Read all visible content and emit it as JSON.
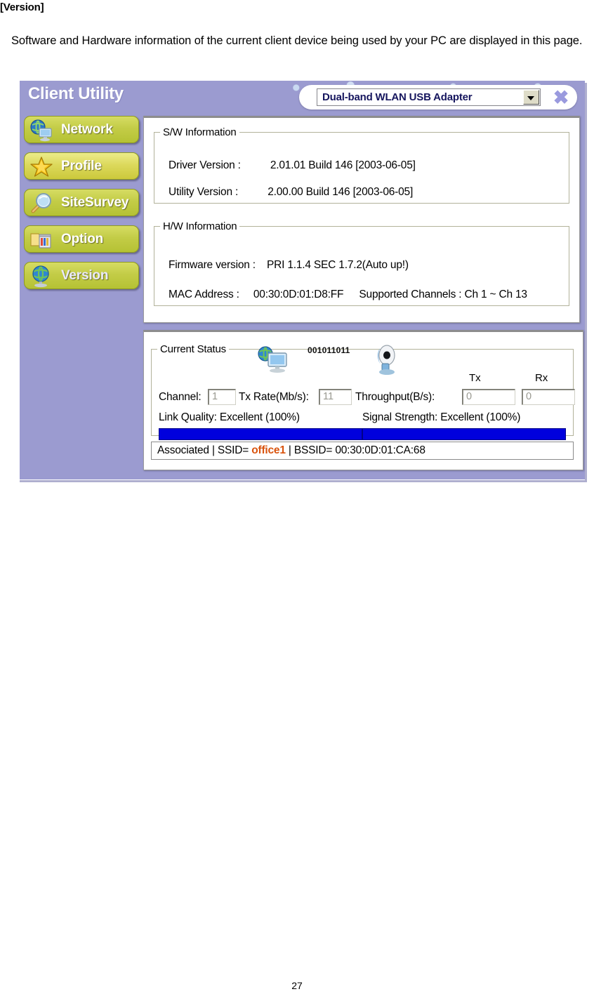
{
  "document": {
    "heading": "[Version]",
    "paragraph": "Software and Hardware information of the current client device being used by your PC are displayed in this page.",
    "page_number": "27"
  },
  "window": {
    "title": "Client Utility",
    "background_color": "#9b9bd0",
    "adapter_selector": {
      "value": "Dual-band WLAN USB Adapter",
      "arrow_icon": "chevron-down-icon"
    },
    "close_label": "✖",
    "close_color": "#9a9ade"
  },
  "sidebar": {
    "items": [
      {
        "label": "Network",
        "icon": "globe-network-icon"
      },
      {
        "label": "Profile",
        "icon": "star-icon"
      },
      {
        "label": "SiteSurvey",
        "icon": "magnifier-icon"
      },
      {
        "label": "Option",
        "icon": "toolbox-icon"
      },
      {
        "label": "Version",
        "icon": "globe-icon"
      }
    ]
  },
  "software_information": {
    "legend": "S/W Information",
    "driver_label": "Driver Version :",
    "driver_value": "2.01.01 Build 146 [2003-06-05]",
    "utility_label": "Utility Version :",
    "utility_value": "2.00.00 Build 146 [2003-06-05]"
  },
  "hardware_information": {
    "legend": "H/W Information",
    "firmware_label": "Firmware version :",
    "firmware_value": "PRI 1.1.4 SEC 1.7.2(Auto up!)",
    "mac_label": "MAC Address :",
    "mac_value": "00:30:0D:01:D8:FF",
    "channels_label": "Supported Channels :",
    "channels_value": "Ch 1 ~ Ch 13"
  },
  "current_status": {
    "legend": "Current Status",
    "binary_decoration": "001011011",
    "pc_icon": "globe-monitor-icon",
    "usb_icon": "usb-adapter-icon",
    "tx_label": "Tx",
    "rx_label": "Rx",
    "channel_label": "Channel:",
    "channel_value": "1",
    "tx_rate_label": "Tx Rate(Mb/s):",
    "tx_rate_value": "11",
    "throughput_label": "Throughput(B/s):",
    "throughput_tx_value": "0",
    "throughput_rx_value": "0",
    "link_quality_label": "Link Quality:",
    "link_quality_value": "Excellent (100%)",
    "link_quality_percent": 100,
    "signal_strength_label": "Signal Strength:",
    "signal_strength_value": "Excellent (100%)",
    "signal_strength_percent": 100,
    "bar_color": "#0000dd"
  },
  "status_bar": {
    "state": "Associated",
    "separator1": "|",
    "ssid_label": "SSID=",
    "ssid_value": "office1",
    "separator2": "|",
    "bssid_label": "BSSID=",
    "bssid_value": "00:30:0D:01:CA:68",
    "ssid_color": "#d9530d"
  }
}
